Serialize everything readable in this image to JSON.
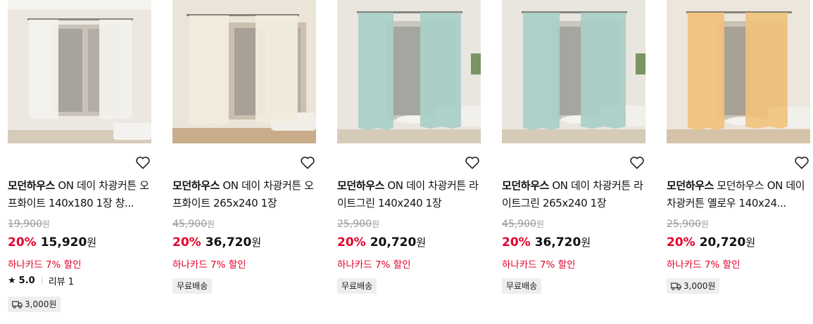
{
  "products": [
    {
      "brand": "모던하우스",
      "name": "ON 데이 차광커튼 오프화이트 140x180 1장 창...",
      "original_price": "19,900",
      "discount": "20%",
      "price": "15,920",
      "currency": "원",
      "card_promo": "하나카드 7% 할인",
      "rating": "5.0",
      "review_label": "리뷰 1",
      "shipping_badge": "3,000원",
      "curtain_color": "#f3f1ec"
    },
    {
      "brand": "모던하우스",
      "name": "ON 데이 차광커튼 오프화이트 265x240 1장",
      "original_price": "45,900",
      "discount": "20%",
      "price": "36,720",
      "currency": "원",
      "card_promo": "하나카드 7% 할인",
      "shipping_badge": "무료배송",
      "curtain_color": "#f1ebdd"
    },
    {
      "brand": "모던하우스",
      "name": "ON 데이 차광커튼 라이트그린 140x240 1장",
      "original_price": "25,900",
      "discount": "20%",
      "price": "20,720",
      "currency": "원",
      "card_promo": "하나카드 7% 할인",
      "shipping_badge": "무료배송",
      "curtain_color": "#a9cfc7"
    },
    {
      "brand": "모던하우스",
      "name": "ON 데이 차광커튼 라이트그린 265x240 1장",
      "original_price": "45,900",
      "discount": "20%",
      "price": "36,720",
      "currency": "원",
      "card_promo": "하나카드 7% 할인",
      "shipping_badge": "무료배송",
      "curtain_color": "#a9cfc7"
    },
    {
      "brand": "모던하우스",
      "name": "모던하우스 ON 데이 차광커튼 옐로우 140x24...",
      "original_price": "25,900",
      "discount": "20%",
      "price": "20,720",
      "currency": "원",
      "card_promo": "하나카드 7% 할인",
      "shipping_badge": "3,000원",
      "curtain_color": "#f1c27a"
    }
  ],
  "colors": {
    "discount_red": "#e4002b",
    "badge_bg": "#eeeeee"
  }
}
